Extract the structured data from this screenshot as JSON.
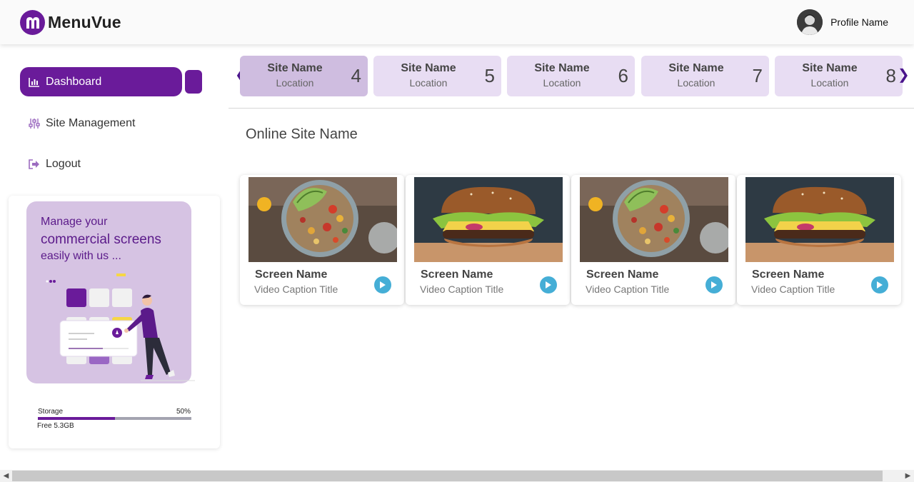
{
  "app": {
    "name": "MenuVue",
    "brand_color": "#6a1b9a"
  },
  "header": {
    "profile_name": "Profile Name"
  },
  "sidebar": {
    "items": [
      {
        "label": "Dashboard",
        "icon": "bar-chart-icon",
        "active": true
      },
      {
        "label": "Site Management",
        "icon": "sliders-icon",
        "active": false
      },
      {
        "label": "Logout",
        "icon": "logout-icon",
        "active": false
      }
    ],
    "promo": {
      "line1": "Manage your",
      "line2": "commercial screens",
      "line3": "easily with us ..."
    },
    "storage": {
      "label": "Storage",
      "percent_text": "50%",
      "percent": 50,
      "free_text": "Free 5.3GB"
    }
  },
  "sites": [
    {
      "name": "Site Name",
      "location": "Location",
      "number": "4",
      "selected": true
    },
    {
      "name": "Site Name",
      "location": "Location",
      "number": "5",
      "selected": false
    },
    {
      "name": "Site Name",
      "location": "Location",
      "number": "6",
      "selected": false
    },
    {
      "name": "Site Name",
      "location": "Location",
      "number": "7",
      "selected": false
    },
    {
      "name": "Site Name",
      "location": "Location",
      "number": "8",
      "selected": false
    }
  ],
  "main": {
    "section_title": "Online Site Name",
    "screens": [
      {
        "name": "Screen Name",
        "caption": "Video Caption Title",
        "image": "salad-bowl"
      },
      {
        "name": "Screen Name",
        "caption": "Video Caption Title",
        "image": "burger"
      },
      {
        "name": "Screen Name",
        "caption": "Video Caption Title",
        "image": "salad-bowl"
      },
      {
        "name": "Screen Name",
        "caption": "Video Caption Title",
        "image": "burger"
      }
    ]
  },
  "colors": {
    "site_card": "#e8ddf3",
    "site_card_selected": "#cfbde0",
    "play_button": "#45aed6"
  }
}
